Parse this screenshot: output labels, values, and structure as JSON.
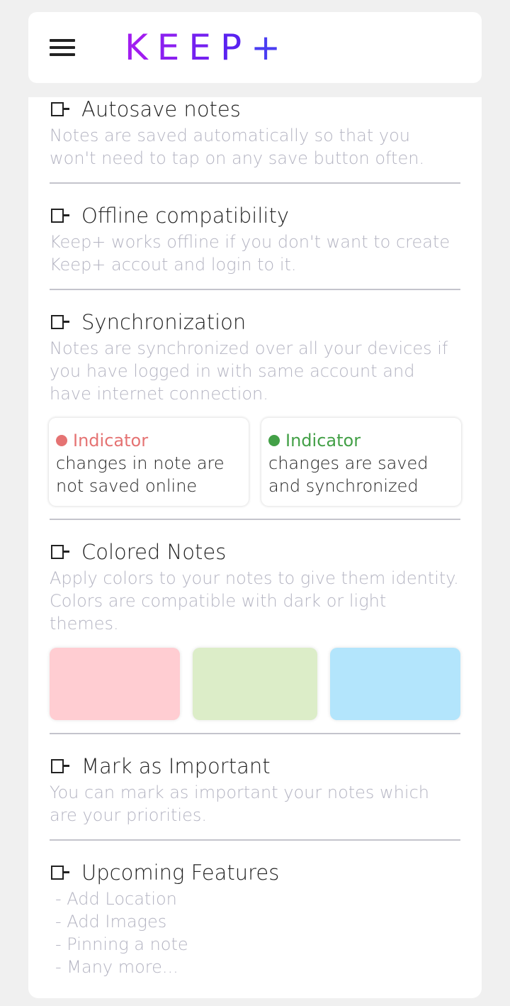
{
  "app": {
    "logo_letters": [
      "K",
      "E",
      "E",
      "P",
      "+"
    ],
    "menu_icon": "hamburger-menu-icon"
  },
  "features": [
    {
      "title": "Autosave notes",
      "description": "Notes are saved automatically so that you won't need to tap on any save button often."
    },
    {
      "title": "Offline compatibility",
      "description": "Keep+ works offline if you don't want to create Keep+ accout and login to it."
    },
    {
      "title": "Synchronization",
      "description": "Notes are synchronized over all your devices if you have logged in with same account and have internet connection."
    },
    {
      "title": "Colored Notes",
      "description": "Apply colors to your notes to give them identity. Colors are compatible with dark or light themes."
    },
    {
      "title": "Mark as Important",
      "description": "You can mark as important your notes which are your priorities."
    },
    {
      "title": "Upcoming Features",
      "items": [
        "- Add Location",
        "- Add Images",
        "- Pinning a note",
        "- Many more..."
      ]
    }
  ],
  "indicators": [
    {
      "label": "Indicator",
      "line1": "changes in note are",
      "line2": "not saved online",
      "color": "#e57373"
    },
    {
      "label": "Indicator",
      "line1": "changes are saved",
      "line2": "and synchronized",
      "color": "#43a047"
    }
  ],
  "color_swatches": [
    "#ffcdd2",
    "#dcedc8",
    "#b3e5fc"
  ]
}
